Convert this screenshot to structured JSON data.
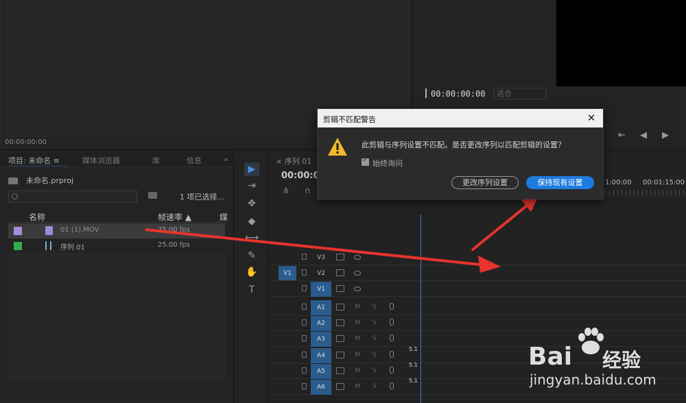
{
  "source_monitor": {
    "timecode": "00:00:00:00"
  },
  "program_monitor": {
    "timecode": "00:00:00:00",
    "fit": "适合"
  },
  "project": {
    "tabs": [
      "项目: 未命名 ≡",
      "媒体浏览器",
      "库",
      "信息"
    ],
    "expand": "»",
    "file": "未命名.prproj",
    "search_placeholder": "",
    "selection": "1 项已选择...",
    "columns": {
      "name": "名称",
      "fps": "帧速率 ▲",
      "extra": "媒"
    },
    "items": [
      {
        "name": "01 (1).MOV",
        "fps": "25.00 fps",
        "swatch": "#a78fd6",
        "icon_color": "#9d8ad8"
      },
      {
        "name": "序列 01",
        "fps": "25.00 fps",
        "swatch": "#2fb14a",
        "icon_color": "#6fb7c8"
      }
    ]
  },
  "tools": [
    "▶",
    "⇥",
    "✥",
    "◆",
    "⟷",
    "✎",
    "✋",
    "T"
  ],
  "timeline": {
    "tab": "序列 01",
    "timecode": "00:00:0",
    "ruler": [
      "1:00:00",
      "00:01:15:00"
    ],
    "source_patch": "V1",
    "video_tracks": [
      "V3",
      "V2",
      "V1"
    ],
    "audio_tracks": [
      "A1",
      "A2",
      "A3",
      "A4",
      "A5",
      "A6"
    ],
    "audio_mute": "M",
    "audio_solo": "S",
    "channel": "5.1"
  },
  "dialog": {
    "title": "剪辑不匹配警告",
    "message": "此剪辑与序列设置不匹配。是否更改序列以匹配剪辑的设置？",
    "checkbox_label": "始终询问",
    "checkbox_checked": true,
    "change_button": "更改序列设置",
    "keep_button": "保持现有设置"
  },
  "watermark": {
    "brand": "Bai",
    "brand2": "经验",
    "url": "jingyan.baidu.com"
  },
  "colors": {
    "accent": "#1e7ce0",
    "track_on": "#2a5c8d",
    "arrow": "#e8332e"
  }
}
